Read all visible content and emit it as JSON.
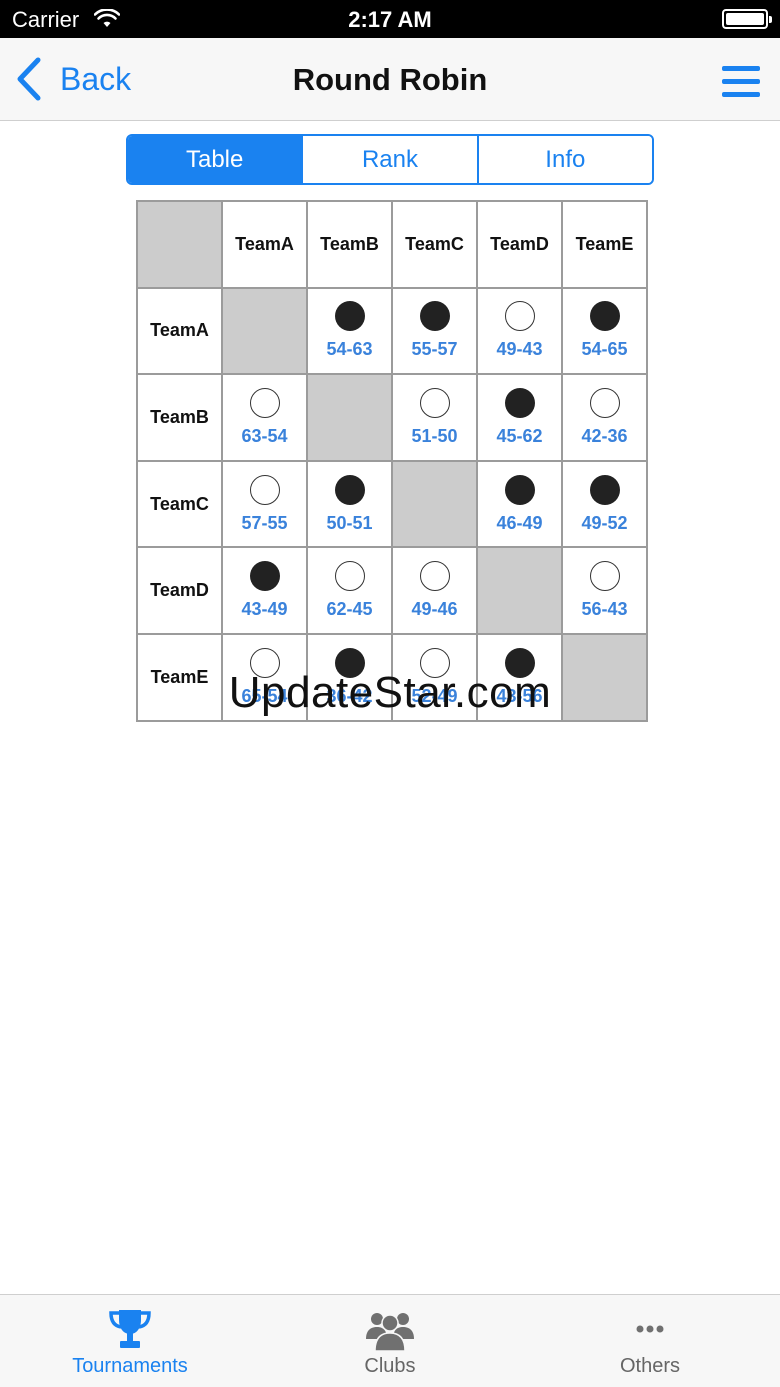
{
  "status_bar": {
    "carrier": "Carrier",
    "time": "2:17 AM"
  },
  "nav": {
    "back_label": "Back",
    "title": "Round Robin"
  },
  "segments": [
    {
      "label": "Table",
      "active": true
    },
    {
      "label": "Rank",
      "active": false
    },
    {
      "label": "Info",
      "active": false
    }
  ],
  "teams": [
    "TeamA",
    "TeamB",
    "TeamC",
    "TeamD",
    "TeamE"
  ],
  "results": [
    [
      null,
      {
        "outcome": "filled",
        "score": "54-63"
      },
      {
        "outcome": "filled",
        "score": "55-57"
      },
      {
        "outcome": "hollow",
        "score": "49-43"
      },
      {
        "outcome": "filled",
        "score": "54-65"
      }
    ],
    [
      {
        "outcome": "hollow",
        "score": "63-54"
      },
      null,
      {
        "outcome": "hollow",
        "score": "51-50"
      },
      {
        "outcome": "filled",
        "score": "45-62"
      },
      {
        "outcome": "hollow",
        "score": "42-36"
      }
    ],
    [
      {
        "outcome": "hollow",
        "score": "57-55"
      },
      {
        "outcome": "filled",
        "score": "50-51"
      },
      null,
      {
        "outcome": "filled",
        "score": "46-49"
      },
      {
        "outcome": "filled",
        "score": "49-52"
      }
    ],
    [
      {
        "outcome": "filled",
        "score": "43-49"
      },
      {
        "outcome": "hollow",
        "score": "62-45"
      },
      {
        "outcome": "hollow",
        "score": "49-46"
      },
      null,
      {
        "outcome": "hollow",
        "score": "56-43"
      }
    ],
    [
      {
        "outcome": "hollow",
        "score": "65-54"
      },
      {
        "outcome": "filled",
        "score": "36-42"
      },
      {
        "outcome": "hollow",
        "score": "52-49"
      },
      {
        "outcome": "filled",
        "score": "43-56"
      },
      null
    ]
  ],
  "watermark": "UpdateStar.com",
  "tab_bar": {
    "items": [
      {
        "label": "Tournaments",
        "icon": "trophy-icon",
        "active": true
      },
      {
        "label": "Clubs",
        "icon": "people-icon",
        "active": false
      },
      {
        "label": "Others",
        "icon": "more-icon",
        "active": false
      }
    ]
  },
  "colors": {
    "accent": "#1a82f0",
    "score_text": "#3a82db",
    "disabled_cell": "#cccccc"
  }
}
